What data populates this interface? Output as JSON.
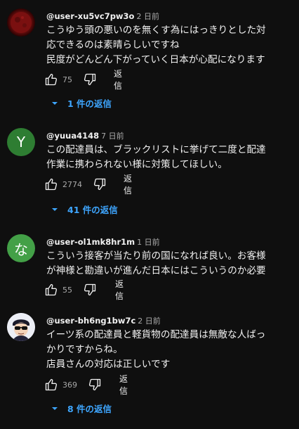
{
  "colors": {
    "background": "#0f0f0f",
    "link_blue": "#3ea6ff",
    "secondary_text": "#aaaaaa",
    "avatar_y": "#2e7d32",
    "avatar_na": "#43a047"
  },
  "comments": [
    {
      "handle": "@user-xu5vc7pw3o",
      "time": "2 日前",
      "avatar": "red-moon-image",
      "lines": [
        "こうゆう頭の悪いのを無くす為にはっきりとした対",
        "応できるのは素晴らしいですね",
        "民度がどんどん下がっていく日本が心配になります"
      ],
      "likes": "75",
      "reply_label": "返信",
      "replies_label": "1 件の返信"
    },
    {
      "handle": "@yuua4148",
      "time": "7 日前",
      "avatar_letter": "Y",
      "lines": [
        "この配達員は、ブラックリストに挙げて二度と配達",
        "作業に携わられない様に対策してほしい。"
      ],
      "likes": "2774",
      "reply_label": "返信",
      "replies_label": "41 件の返信"
    },
    {
      "handle": "@user-ol1mk8hr1m",
      "time": "1 日前",
      "avatar_letter": "な",
      "lines": [
        "こういう接客が当たり前の国になれば良い。お客様",
        "が神様と勘違いが進んだ日本にはこういうのか必要"
      ],
      "likes": "55",
      "reply_label": "返信"
    },
    {
      "handle": "@user-bh6ng1bw7c",
      "time": "2 日前",
      "avatar": "cartoon-sunglasses-character",
      "lines": [
        "イーツ系の配達員と軽貨物の配達員は無敵な人ばっ",
        "かりですからね。",
        "店員さんの対応は正しいです"
      ],
      "likes": "369",
      "reply_label": "返信",
      "replies_label": "8 件の返信"
    }
  ]
}
